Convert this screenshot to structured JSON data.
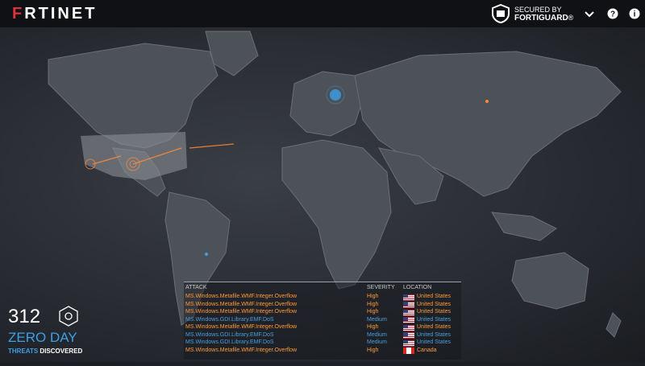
{
  "header": {
    "logo_prefix": "F",
    "logo_rest": "RTINET",
    "secured_by_line1": "SECURED BY",
    "secured_by_line2": "FORTIGUARD",
    "reg_mark": "®"
  },
  "icons": {
    "shield": "fortiguard-shield-icon",
    "dropdown": "chevron-down-icon",
    "help": "help-icon",
    "info": "info-icon"
  },
  "stats": {
    "count": "312",
    "label": "ZERO DAY",
    "sub_prefix": "THREATS",
    "sub_suffix": "DISCOVERED"
  },
  "attack_table": {
    "columns": [
      "ATTACK",
      "SEVERITY",
      "LOCATION"
    ],
    "rows": [
      {
        "attack": "MS.Windows.Metafile.WMF.Integer.Overflow",
        "severity": "High",
        "location": "United States",
        "flag": "us"
      },
      {
        "attack": "MS.Windows.Metafile.WMF.Integer.Overflow",
        "severity": "High",
        "location": "United States",
        "flag": "us"
      },
      {
        "attack": "MS.Windows.Metafile.WMF.Integer.Overflow",
        "severity": "High",
        "location": "United States",
        "flag": "us"
      },
      {
        "attack": "MS.Windows.GDI.Library.EMF.DoS",
        "severity": "Medium",
        "location": "United States",
        "flag": "us"
      },
      {
        "attack": "MS.Windows.Metafile.WMF.Integer.Overflow",
        "severity": "High",
        "location": "United States",
        "flag": "us"
      },
      {
        "attack": "MS.Windows.GDI.Library.EMF.DoS",
        "severity": "Medium",
        "location": "United States",
        "flag": "us"
      },
      {
        "attack": "MS.Windows.GDI.Library.EMF.DoS",
        "severity": "Medium",
        "location": "United States",
        "flag": "us"
      },
      {
        "attack": "MS.Windows.Metafile.WMF.Integer.Overflow",
        "severity": "High",
        "location": "Canada",
        "flag": "ca"
      }
    ]
  },
  "colors": {
    "high": "#ff9a3a",
    "medium": "#4a9fe0",
    "accent_blue": "#3aa0e8",
    "brand_red": "#e0323a"
  }
}
